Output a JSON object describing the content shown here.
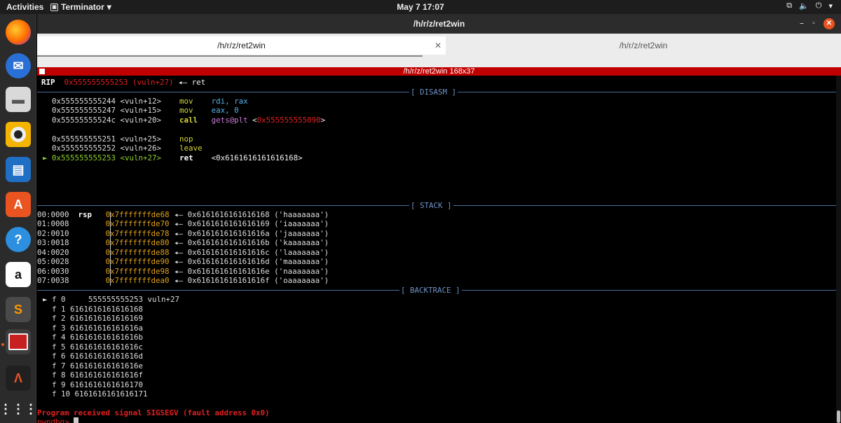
{
  "topbar": {
    "activities": "Activities",
    "app_name": "Terminator",
    "clock": "May 7  17:07"
  },
  "window": {
    "title": "/h/r/z/ret2win",
    "minimize": "–",
    "maximize": "▫",
    "close": "✕"
  },
  "tabs": [
    {
      "label": "/h/r/z/ret2win",
      "close": "✕"
    },
    {
      "label": "/h/r/z/ret2win"
    }
  ],
  "terminal_title": "/h/r/z/ret2win 168x37",
  "rip": {
    "label": "RIP",
    "addr": "0x555555555253 (vuln+27)",
    "arrow": "◂— ret"
  },
  "sections": {
    "disasm": "[ DISASM ]",
    "stack": "[ STACK ]",
    "backtrace": "[ BACKTRACE ]"
  },
  "disasm": [
    {
      "addr": "0x555555555244 <vuln+12>",
      "mnem": "mov",
      "ops": "rdi, rax"
    },
    {
      "addr": "0x555555555247 <vuln+15>",
      "mnem": "mov",
      "ops": "eax, 0"
    },
    {
      "addr": "0x55555555524c <vuln+20>",
      "mnem": "call",
      "ops": "gets@plt",
      "target_open": "<",
      "target": "0x555555555090",
      "target_close": ">"
    },
    {
      "addr": "0x555555555251 <vuln+25>",
      "mnem": "nop",
      "ops": ""
    },
    {
      "addr": "0x555555555252 <vuln+26>",
      "mnem": "leave",
      "ops": ""
    },
    {
      "marker": "►",
      "addr": "0x555555555253 <vuln+27>",
      "mnem": "ret",
      "ops": "<0x6161616161616168>"
    }
  ],
  "stack": [
    {
      "off": "00:0000",
      "reg": "rsp",
      "addr": "0x7fffffffde68",
      "arrow": "◂—",
      "val": "0x6161616161616168 ('haaaaaaa')"
    },
    {
      "off": "01:0008",
      "reg": "",
      "addr": "0x7fffffffde70",
      "arrow": "◂—",
      "val": "0x6161616161616169 ('iaaaaaaa')"
    },
    {
      "off": "02:0010",
      "reg": "",
      "addr": "0x7fffffffde78",
      "arrow": "◂—",
      "val": "0x616161616161616a ('jaaaaaaa')"
    },
    {
      "off": "03:0018",
      "reg": "",
      "addr": "0x7fffffffde80",
      "arrow": "◂—",
      "val": "0x616161616161616b ('kaaaaaaa')"
    },
    {
      "off": "04:0020",
      "reg": "",
      "addr": "0x7fffffffde88",
      "arrow": "◂—",
      "val": "0x616161616161616c ('laaaaaaa')"
    },
    {
      "off": "05:0028",
      "reg": "",
      "addr": "0x7fffffffde90",
      "arrow": "◂—",
      "val": "0x616161616161616d ('maaaaaaa')"
    },
    {
      "off": "06:0030",
      "reg": "",
      "addr": "0x7fffffffde98",
      "arrow": "◂—",
      "val": "0x616161616161616e ('naaaaaaa')"
    },
    {
      "off": "07:0038",
      "reg": "",
      "addr": "0x7fffffffdea0",
      "arrow": "◂—",
      "val": "0x616161616161616f ('oaaaaaaa')"
    }
  ],
  "backtrace": [
    {
      "marker": "►",
      "text": "f 0     555555555253 vuln+27"
    },
    {
      "text": "f 1 6161616161616168"
    },
    {
      "text": "f 2 6161616161616169"
    },
    {
      "text": "f 3 616161616161616a"
    },
    {
      "text": "f 4 616161616161616b"
    },
    {
      "text": "f 5 616161616161616c"
    },
    {
      "text": "f 6 616161616161616d"
    },
    {
      "text": "f 7 616161616161616e"
    },
    {
      "text": "f 8 616161616161616f"
    },
    {
      "text": "f 9 6161616161616170"
    },
    {
      "text": "f 10 6161616161616171"
    }
  ],
  "signal": "Program received signal SIGSEGV (fault address 0x0)",
  "prompt": "pwndbg>",
  "dock": [
    {
      "name": "firefox",
      "icon": "firefox-icon",
      "color": "#e66000"
    },
    {
      "name": "thunderbird",
      "icon": "thunderbird-icon",
      "color": "#2a6fd6"
    },
    {
      "name": "files",
      "icon": "folder-icon",
      "color": "#d9d9d9"
    },
    {
      "name": "rhythmbox",
      "icon": "rhythmbox-icon",
      "color": "#f4b400"
    },
    {
      "name": "writer",
      "icon": "writer-icon",
      "color": "#1f6fc5"
    },
    {
      "name": "software",
      "icon": "software-icon",
      "color": "#e95420"
    },
    {
      "name": "help",
      "icon": "help-icon",
      "color": "#2d8fe0"
    },
    {
      "name": "amazon",
      "icon": "amazon-icon",
      "color": "#ffffff"
    },
    {
      "name": "sublime",
      "icon": "sublime-icon",
      "color": "#4a4a4a"
    },
    {
      "name": "terminator",
      "icon": "terminator-icon",
      "color": "#c62020"
    },
    {
      "name": "arduino",
      "icon": "arduino-icon",
      "color": "#202020"
    },
    {
      "name": "apps",
      "icon": "app-grid-icon",
      "color": "#2b2b2b"
    }
  ]
}
